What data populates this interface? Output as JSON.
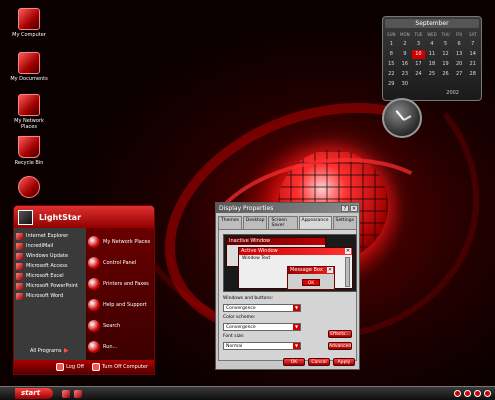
{
  "desktop": {
    "icons": [
      {
        "label": "My Computer",
        "icon": "computer-icon"
      },
      {
        "label": "My Documents",
        "icon": "documents-icon"
      },
      {
        "label": "My Network Places",
        "icon": "network-icon"
      },
      {
        "label": "Recycle Bin",
        "icon": "recycle-bin-icon"
      },
      {
        "label": "",
        "icon": "power-icon"
      }
    ]
  },
  "calendar": {
    "month": "September",
    "year": "2002",
    "day_names": [
      "SUN",
      "MON",
      "TUE",
      "WED",
      "THU",
      "FRI",
      "SAT"
    ],
    "days": [
      "1",
      "2",
      "3",
      "4",
      "5",
      "6",
      "7",
      "8",
      "9",
      "10",
      "11",
      "12",
      "13",
      "14",
      "15",
      "16",
      "17",
      "18",
      "19",
      "20",
      "21",
      "22",
      "23",
      "24",
      "25",
      "26",
      "27",
      "28",
      "29",
      "30"
    ],
    "today": "10"
  },
  "start_menu": {
    "user": "LightStar",
    "left_items": [
      "Internet Explorer",
      "IncrediMail",
      "Windows Update",
      "Microsoft Access",
      "Microsoft Excel",
      "Microsoft PowerPoint",
      "Microsoft Word"
    ],
    "right_items": [
      "My Network Places",
      "Control Panel",
      "Printers and Faxes",
      "Help and Support",
      "Search",
      "Run..."
    ],
    "all_programs": "All Programs",
    "log_off": "Log Off",
    "turn_off": "Turn Off Computer"
  },
  "dialog": {
    "title": "Display Properties",
    "tabs": [
      "Themes",
      "Desktop",
      "Screen Saver",
      "Appearance",
      "Settings"
    ],
    "active_tab": "Appearance",
    "preview": {
      "inactive_window": "Inactive Window",
      "active_window": "Active Window",
      "window_text": "Window Text",
      "message_box": "Message Box",
      "ok": "OK"
    },
    "windows_buttons_label": "Windows and buttons:",
    "windows_buttons_value": "Convergence",
    "color_scheme_label": "Color scheme:",
    "color_scheme_value": "Convergence",
    "font_size_label": "Font size:",
    "font_size_value": "Normal",
    "effects_button": "Effects...",
    "advanced_button": "Advanced",
    "ok_button": "OK",
    "cancel_button": "Cancel",
    "apply_button": "Apply"
  },
  "taskbar": {
    "start": "start"
  }
}
